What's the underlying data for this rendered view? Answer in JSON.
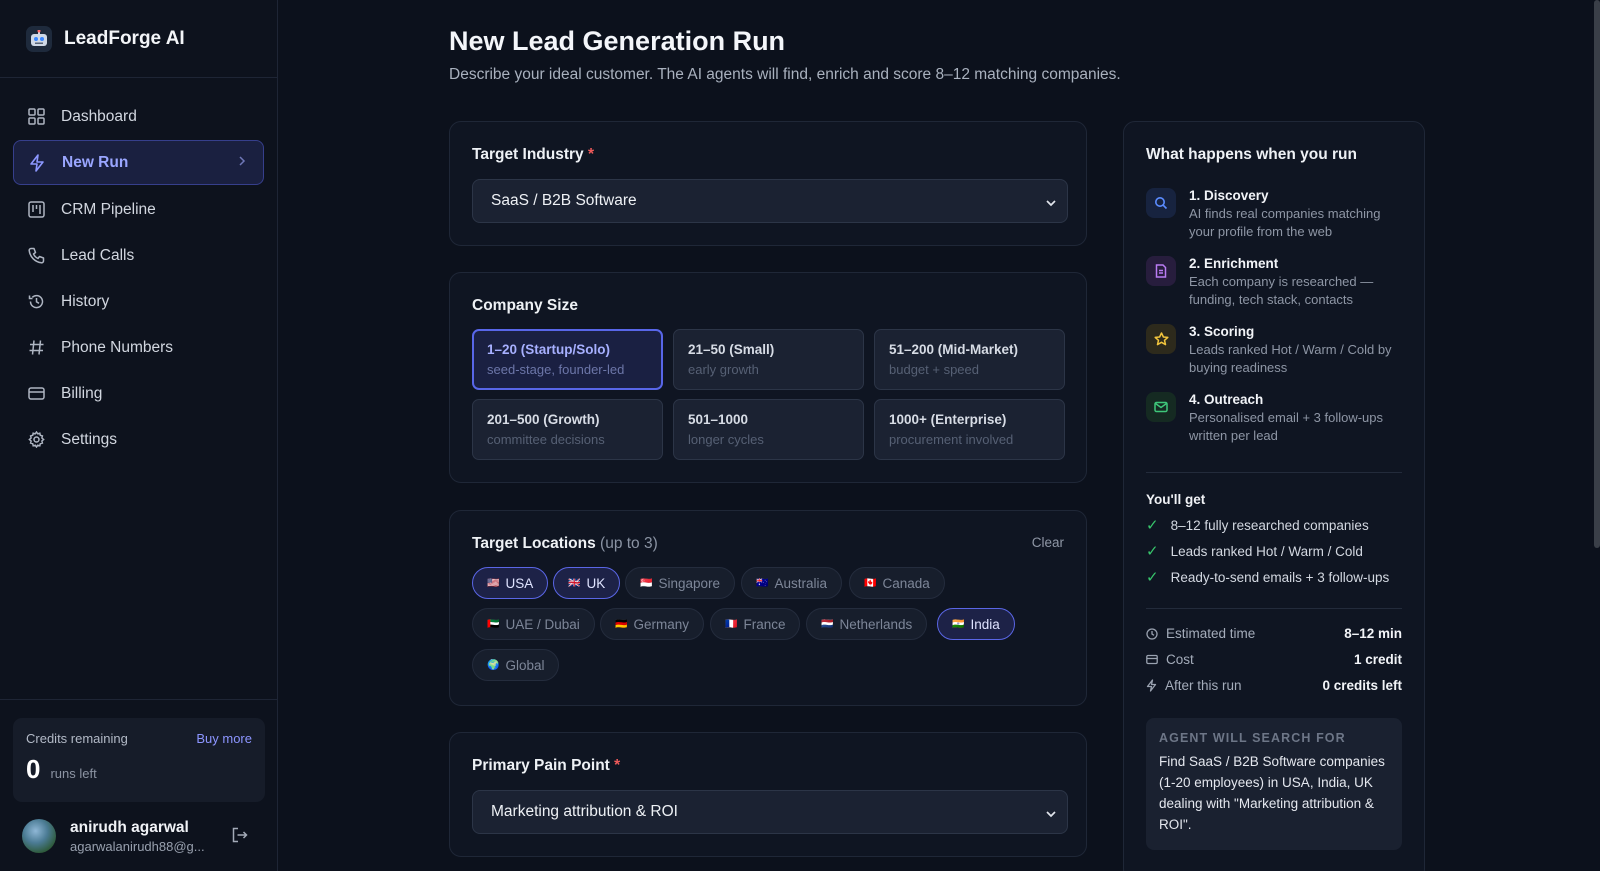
{
  "brand": {
    "name": "LeadForge AI",
    "icon": "robot-icon"
  },
  "nav": {
    "items": [
      {
        "label": "Dashboard",
        "icon": "grid-icon"
      },
      {
        "label": "New Run",
        "icon": "lightning-icon",
        "active": true
      },
      {
        "label": "CRM Pipeline",
        "icon": "kanban-icon"
      },
      {
        "label": "Lead Calls",
        "icon": "phone-icon"
      },
      {
        "label": "History",
        "icon": "history-icon"
      },
      {
        "label": "Phone Numbers",
        "icon": "hash-icon"
      },
      {
        "label": "Billing",
        "icon": "card-icon"
      },
      {
        "label": "Settings",
        "icon": "gear-icon"
      }
    ]
  },
  "credits": {
    "label": "Credits remaining",
    "buy_more": "Buy more",
    "count": "0",
    "unit": "runs left"
  },
  "user": {
    "name": "anirudh agarwal",
    "email": "agarwalanirudh88@g..."
  },
  "page": {
    "title": "New Lead Generation Run",
    "subtitle": "Describe your ideal customer. The AI agents will find, enrich and score 8–12 matching companies."
  },
  "industry": {
    "label": "Target Industry",
    "required": "*",
    "value": "SaaS / B2B Software"
  },
  "company_size": {
    "label": "Company Size",
    "options": [
      {
        "title": "1–20 (Startup/Solo)",
        "desc": "seed-stage, founder-led",
        "selected": true
      },
      {
        "title": "21–50 (Small)",
        "desc": "early growth"
      },
      {
        "title": "51–200 (Mid-Market)",
        "desc": "budget + speed"
      },
      {
        "title": "201–500 (Growth)",
        "desc": "committee decisions"
      },
      {
        "title": "501–1000",
        "desc": "longer cycles"
      },
      {
        "title": "1000+ (Enterprise)",
        "desc": "procurement involved"
      }
    ]
  },
  "locations": {
    "label": "Target Locations",
    "hint": "(up to 3)",
    "clear": "Clear",
    "chips": [
      {
        "flag": "🇺🇸",
        "label": "USA",
        "selected": true
      },
      {
        "flag": "🇬🇧",
        "label": "UK",
        "selected": true
      },
      {
        "flag": "🇸🇬",
        "label": "Singapore"
      },
      {
        "flag": "🇦🇺",
        "label": "Australia"
      },
      {
        "flag": "🇨🇦",
        "label": "Canada"
      },
      {
        "flag": "🇦🇪",
        "label": "UAE / Dubai"
      },
      {
        "flag": "🇩🇪",
        "label": "Germany"
      },
      {
        "flag": "🇫🇷",
        "label": "France"
      },
      {
        "flag": "🇳🇱",
        "label": "Netherlands"
      },
      {
        "flag": "🇮🇳",
        "label": "India",
        "selected": true
      },
      {
        "flag": "🌍",
        "label": "Global"
      }
    ]
  },
  "pain_point": {
    "label": "Primary Pain Point",
    "required": "*",
    "value": "Marketing attribution & ROI"
  },
  "panel": {
    "title": "What happens when you run",
    "steps": [
      {
        "title": "1. Discovery",
        "desc": "AI finds real companies matching your profile from the web",
        "icon": "search-icon",
        "color": "#5b8cff"
      },
      {
        "title": "2. Enrichment",
        "desc": "Each company is researched — funding, tech stack, contacts",
        "icon": "document-icon",
        "color": "#b97cf3"
      },
      {
        "title": "3. Scoring",
        "desc": "Leads ranked Hot / Warm / Cold by buying readiness",
        "icon": "star-icon",
        "color": "#f2c53d"
      },
      {
        "title": "4. Outreach",
        "desc": "Personalised email + 3 follow-ups written per lead",
        "icon": "mail-icon",
        "color": "#3ec77a"
      }
    ],
    "get_title": "You'll get",
    "get_items": [
      "8–12 fully researched companies",
      "Leads ranked Hot / Warm / Cold",
      "Ready-to-send emails + 3 follow-ups"
    ],
    "meta": [
      {
        "label": "Estimated time",
        "value": "8–12 min",
        "icon": "clock-icon"
      },
      {
        "label": "Cost",
        "value": "1 credit",
        "icon": "card-icon"
      },
      {
        "label": "After this run",
        "value": "0 credits left",
        "icon": "lightning-icon"
      }
    ],
    "search_label": "AGENT WILL SEARCH FOR",
    "search_text": "Find SaaS / B2B Software companies (1-20 employees) in USA, India, UK dealing with \"Marketing attribution & ROI\"."
  }
}
